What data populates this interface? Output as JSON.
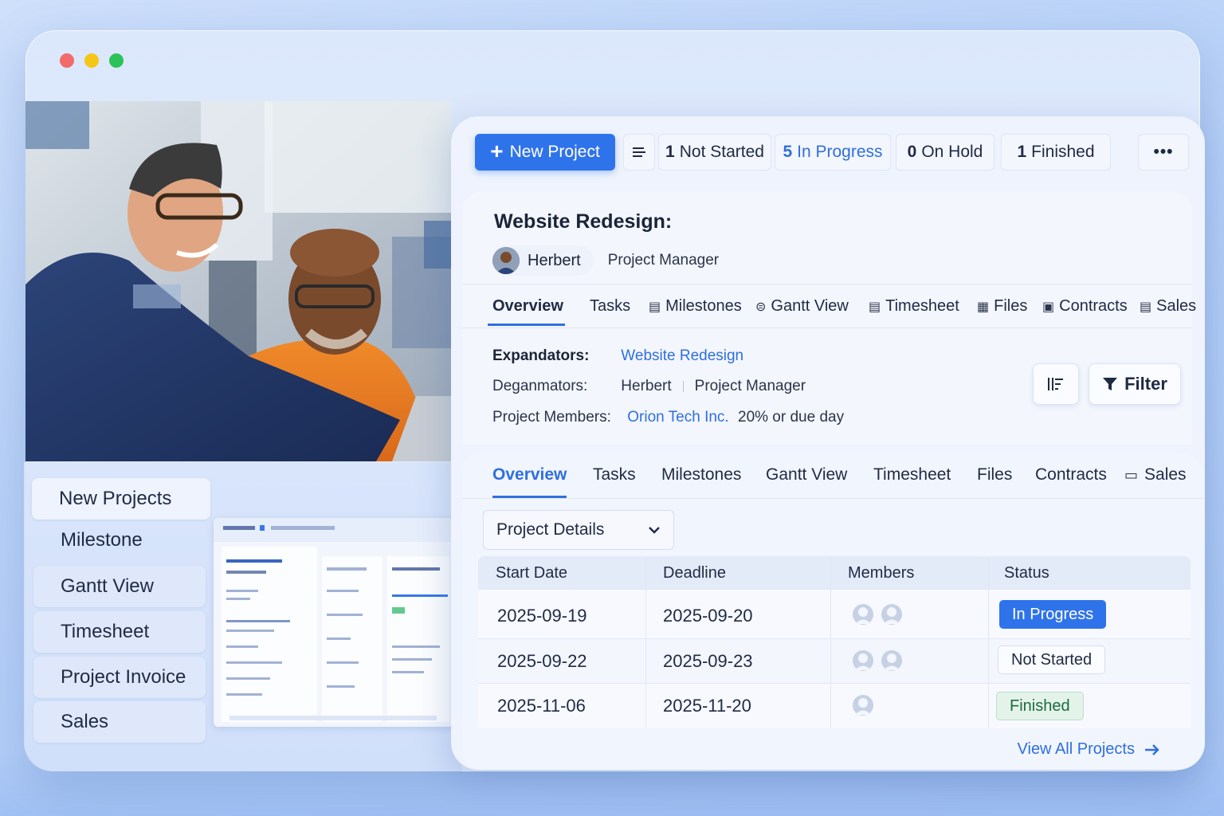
{
  "window": {
    "controls": [
      "close",
      "minimize",
      "maximize"
    ]
  },
  "sidebar": {
    "items": [
      {
        "label": "New Projects"
      },
      {
        "label": "Milestone"
      },
      {
        "label": "Gantt View"
      },
      {
        "label": "Timesheet"
      },
      {
        "label": "Project Invoice"
      },
      {
        "label": "Sales"
      }
    ]
  },
  "toolbar": {
    "new_project_label": "New Project",
    "filters": [
      {
        "count": "1",
        "label": "Not Started"
      },
      {
        "count": "5",
        "label": "In Progress"
      },
      {
        "count": "0",
        "label": "On Hold"
      },
      {
        "count": "1",
        "label": "Finished"
      }
    ],
    "more_label": "•••"
  },
  "project": {
    "title": "Website Redesign:",
    "manager_name": "Herbert",
    "manager_role": "Project Manager"
  },
  "tabs_top": [
    "Overview",
    "Tasks",
    "Milestones",
    "Gantt View",
    "Timesheet",
    "Files",
    "Contracts",
    "Sales"
  ],
  "details": {
    "row1_label": "Expandators:",
    "row1_value": "Website Redesign",
    "row2_label": "Deganmators:",
    "row2_name": "Herbert",
    "row2_role": "Project Manager",
    "row3_label": "Project Members:",
    "row3_company": "Orion Tech Inc.",
    "row3_note": "20% or due day",
    "filter_label": "Filter"
  },
  "tabs_bottom": [
    "Overview",
    "Tasks",
    "Milestones",
    "Gantt View",
    "Timesheet",
    "Files",
    "Contracts",
    "Sales"
  ],
  "project_details_select": "Project Details",
  "table": {
    "headers": [
      "Start Date",
      "Deadline",
      "Members",
      "Status"
    ],
    "rows": [
      {
        "start": "2025-09-19",
        "deadline": "2025-09-20",
        "members": 2,
        "status": "In Progress"
      },
      {
        "start": "2025-09-22",
        "deadline": "2025-09-23",
        "members": 2,
        "status": "Not Started"
      },
      {
        "start": "2025-11-06",
        "deadline": "2025-11-20",
        "members": 1,
        "status": "Finished"
      }
    ]
  },
  "view_all_label": "View All Projects",
  "colors": {
    "accent": "#2f73ea",
    "finished_bg": "#e3f3ea",
    "finished_text": "#1e6b3d"
  }
}
